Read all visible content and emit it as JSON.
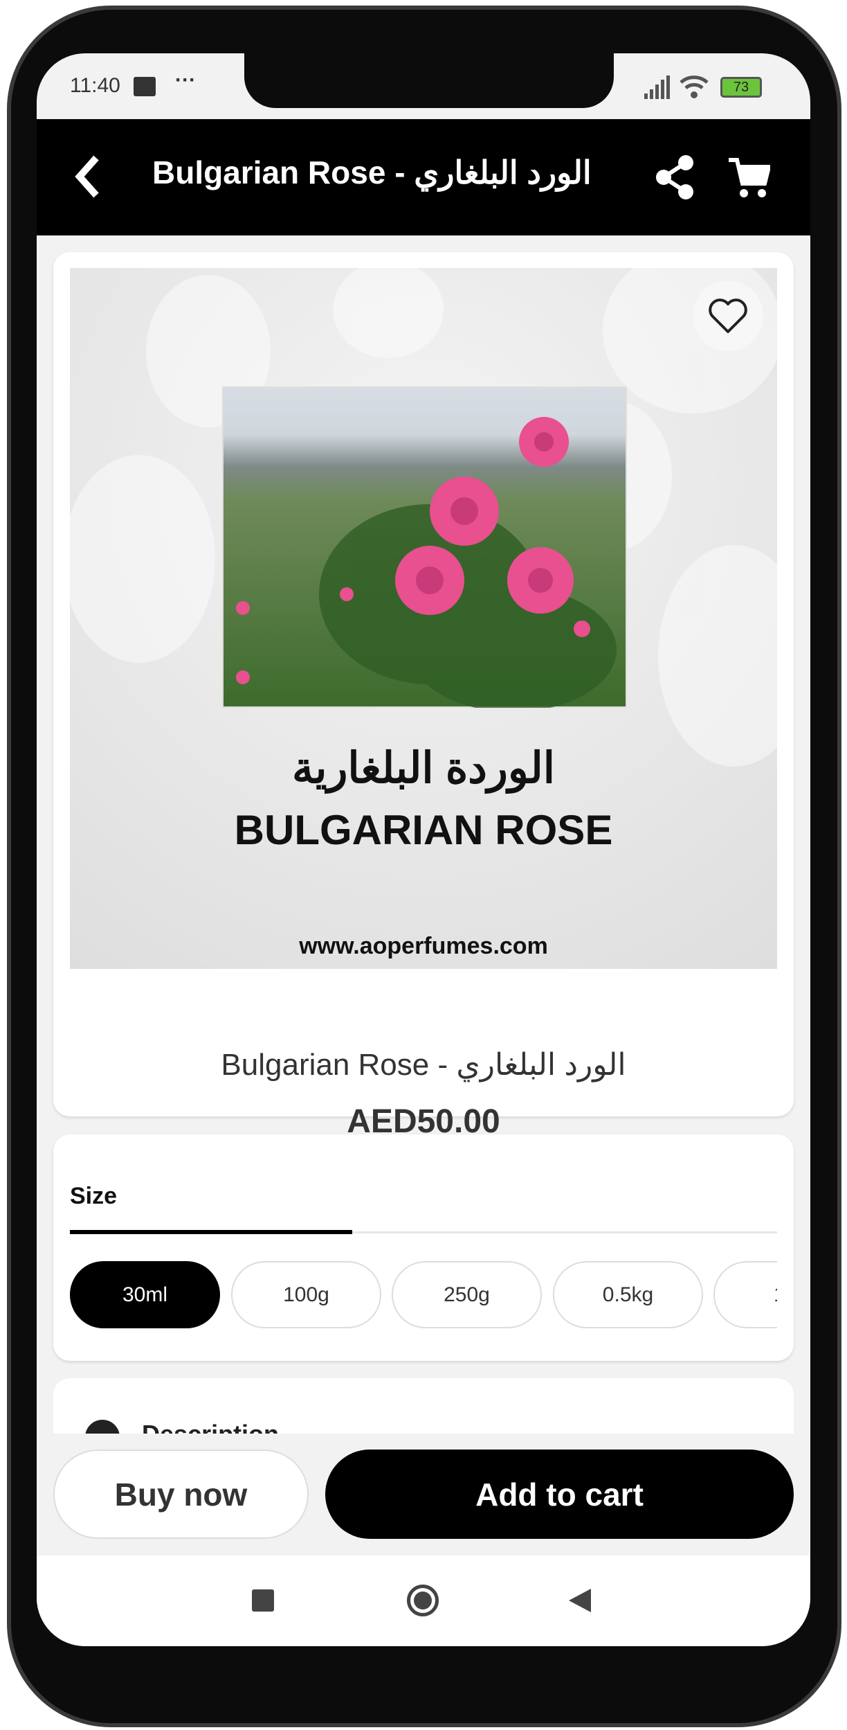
{
  "status_bar": {
    "time": "11:40",
    "battery": "73",
    "icons": [
      "message-icon",
      "more-dots-icon",
      "signal-icon",
      "wifi-icon",
      "battery-icon"
    ]
  },
  "header": {
    "title": "Bulgarian Rose - الورد البلغاري",
    "icons": [
      "back-icon",
      "share-icon",
      "cart-icon"
    ]
  },
  "product": {
    "image_text_arabic": "الوردة البلغارية",
    "image_text_english": "BULGARIAN ROSE",
    "image_url_text": "www.aoperfumes.com",
    "name": "Bulgarian Rose - الورد البلغاري",
    "price": "AED50.00",
    "favorite_icon": "heart-outline-icon"
  },
  "size": {
    "label": "Size",
    "options": [
      "30ml",
      "100g",
      "250g",
      "0.5kg",
      "1"
    ],
    "selected": "30ml"
  },
  "description": {
    "label": "Description",
    "icon": "info-icon"
  },
  "actions": {
    "buy_now": "Buy now",
    "add_to_cart": "Add to cart"
  },
  "nav": {
    "icons": [
      "recents-square-icon",
      "home-circle-icon",
      "back-triangle-icon"
    ]
  },
  "colors": {
    "primary": "#000000",
    "background": "#f2f2f2",
    "battery": "#6cc43c"
  }
}
